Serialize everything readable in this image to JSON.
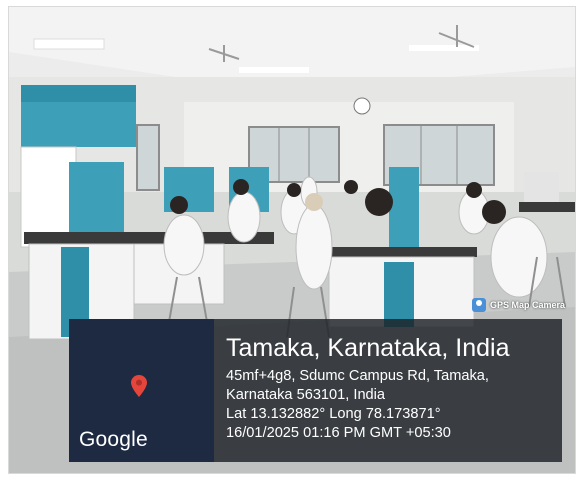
{
  "badge": {
    "label": "GPS Map Camera",
    "icon": "gps-map-camera-icon"
  },
  "map": {
    "brand": "Google",
    "pin_color": "#e5453b",
    "pin_icon": "map-pin-icon"
  },
  "location": {
    "title": "Tamaka, Karnataka, India",
    "address_line_1": "45mf+4g8, Sdumc Campus Rd, Tamaka,",
    "address_line_2": "Karnataka 563101, India",
    "coordinates": "Lat 13.132882° Long 78.173871°",
    "datetime": "16/01/2025 01:16 PM GMT +05:30"
  }
}
